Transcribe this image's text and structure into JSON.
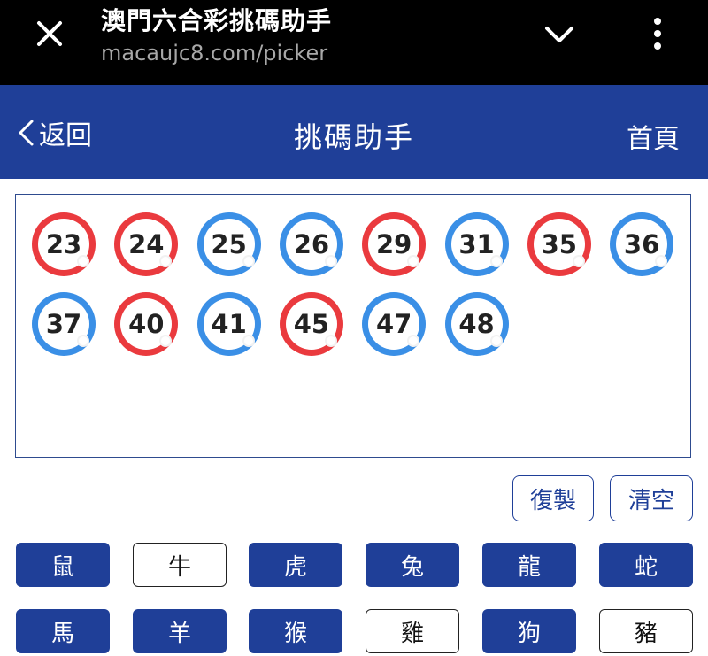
{
  "browser": {
    "title": "澳門六合彩挑碼助手",
    "url": "macaujc8.com/picker"
  },
  "nav": {
    "back_label": "返回",
    "page_title": "挑碼助手",
    "home_label": "首頁"
  },
  "colors": {
    "red": "#ea3a3e",
    "blue": "#3a8fe6",
    "brand": "#1f3f98"
  },
  "numbers": [
    {
      "n": "23",
      "color": "red"
    },
    {
      "n": "24",
      "color": "red"
    },
    {
      "n": "25",
      "color": "blue"
    },
    {
      "n": "26",
      "color": "blue"
    },
    {
      "n": "29",
      "color": "red"
    },
    {
      "n": "31",
      "color": "blue"
    },
    {
      "n": "35",
      "color": "red"
    },
    {
      "n": "36",
      "color": "blue"
    },
    {
      "n": "37",
      "color": "blue"
    },
    {
      "n": "40",
      "color": "red"
    },
    {
      "n": "41",
      "color": "blue"
    },
    {
      "n": "45",
      "color": "red"
    },
    {
      "n": "47",
      "color": "blue"
    },
    {
      "n": "48",
      "color": "blue"
    }
  ],
  "actions": {
    "copy_label": "復製",
    "clear_label": "清空"
  },
  "zodiac": [
    {
      "label": "鼠",
      "selected": true
    },
    {
      "label": "牛",
      "selected": false
    },
    {
      "label": "虎",
      "selected": true
    },
    {
      "label": "兔",
      "selected": true
    },
    {
      "label": "龍",
      "selected": true
    },
    {
      "label": "蛇",
      "selected": true
    },
    {
      "label": "馬",
      "selected": true
    },
    {
      "label": "羊",
      "selected": true
    },
    {
      "label": "猴",
      "selected": true
    },
    {
      "label": "雞",
      "selected": false
    },
    {
      "label": "狗",
      "selected": true
    },
    {
      "label": "豬",
      "selected": false
    }
  ]
}
